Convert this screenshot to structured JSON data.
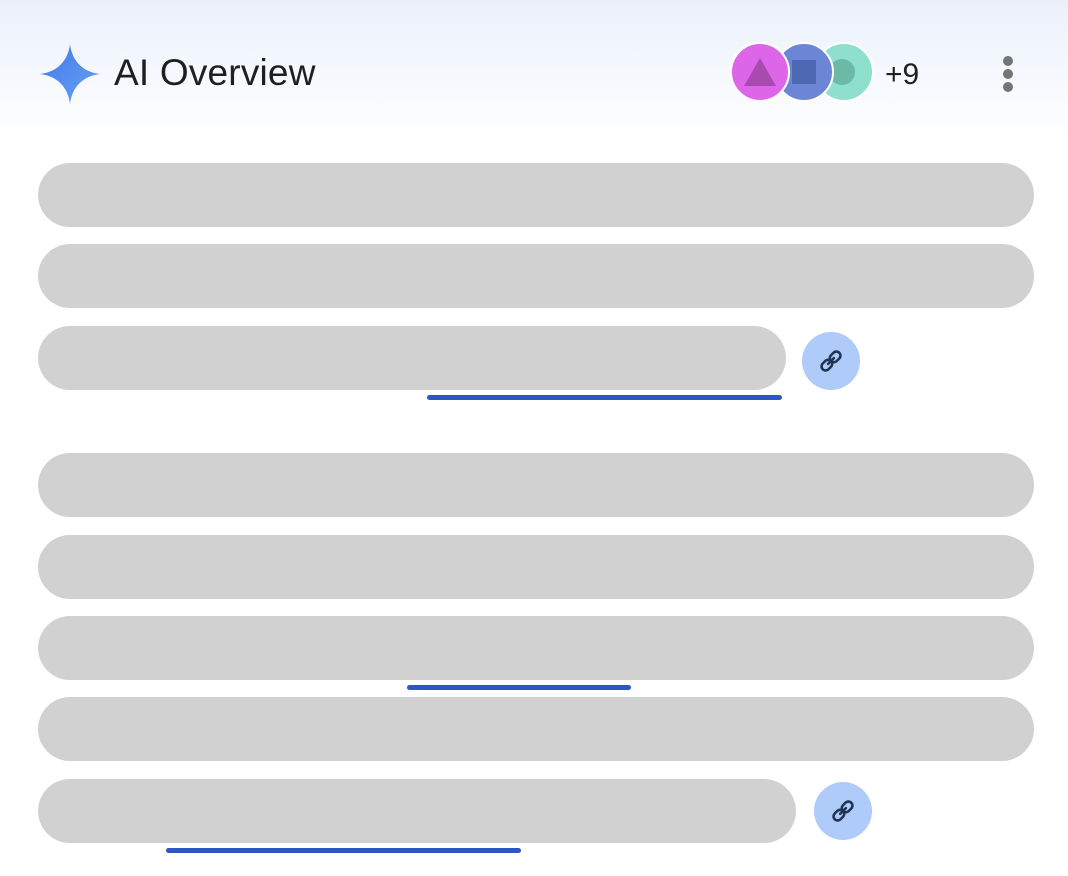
{
  "header": {
    "title": "AI Overview",
    "more_sources_count": "+9",
    "sparkle_icon": "gemini-sparkle-icon",
    "menu_icon": "more-vert-icon",
    "source_avatars": [
      {
        "icon": "triangle-icon",
        "color": "#dd66e8"
      },
      {
        "icon": "square-icon",
        "color": "#6c86d6"
      },
      {
        "icon": "circle-icon",
        "color": "#8ee0cc"
      }
    ]
  },
  "content": {
    "paragraphs": [
      {
        "lines": 3,
        "link_icon": "link-icon",
        "citation_underlines": 1
      },
      {
        "lines": 5,
        "link_icon": "link-icon",
        "citation_underlines": 2
      }
    ]
  },
  "colors": {
    "sparkle": "#4d84f2",
    "placeholder": "#d1d1d1",
    "citation_underline": "#2b56c4",
    "link_chip": "#aecbfa",
    "text": "#1f1f1f"
  }
}
